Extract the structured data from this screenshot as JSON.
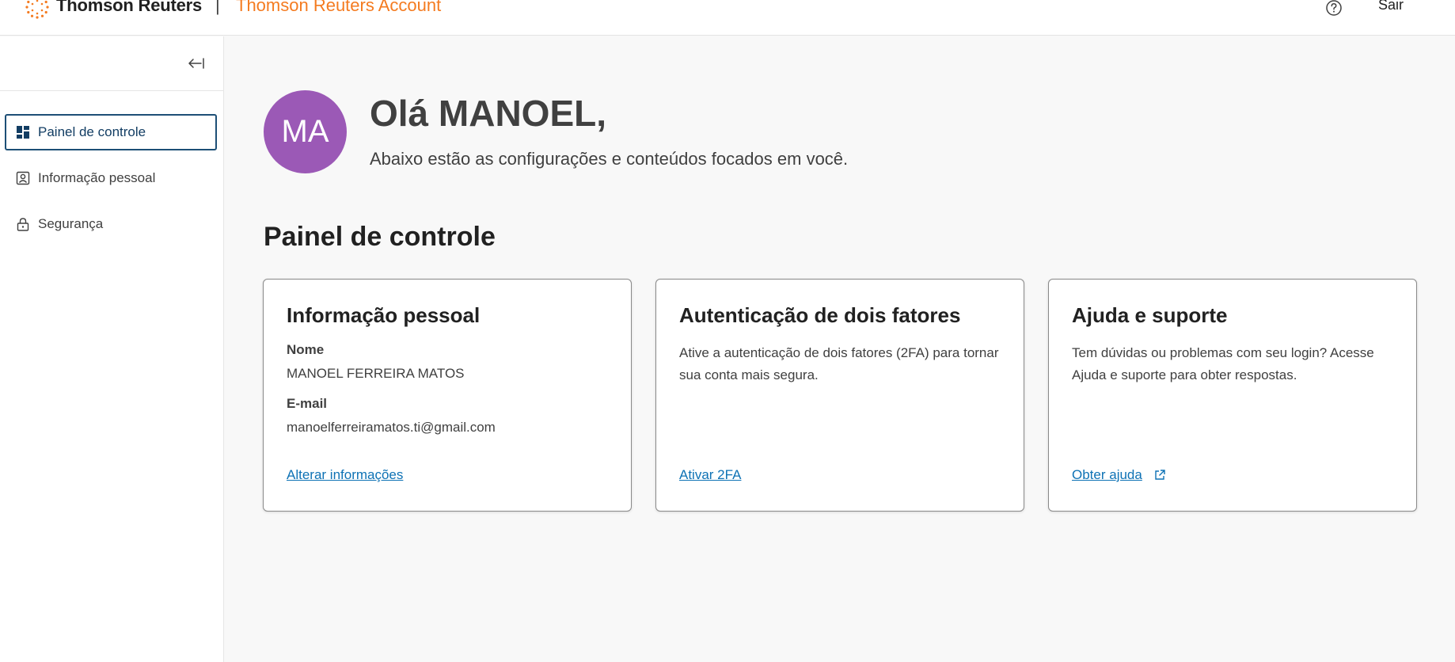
{
  "header": {
    "brand": "Thomson Reuters",
    "separator": "|",
    "product": "Thomson Reuters Account",
    "logout_label": "Sair",
    "help_icon": "question-circle-icon"
  },
  "sidebar": {
    "collapse_icon": "collapse-left-icon",
    "items": [
      {
        "label": "Painel de controle",
        "icon": "dashboard-icon",
        "active": true
      },
      {
        "label": "Informação pessoal",
        "icon": "person-card-icon",
        "active": false
      },
      {
        "label": "Segurança",
        "icon": "lock-icon",
        "active": false
      }
    ]
  },
  "main": {
    "avatar_initials": "MA",
    "avatar_color": "#9b59b6",
    "greeting": "Olá MANOEL,",
    "subtitle": "Abaixo estão as configurações e conteúdos focados em você.",
    "section_title": "Painel de controle",
    "cards": [
      {
        "title": "Informação pessoal",
        "name_label": "Nome",
        "name_value": "MANOEL FERREIRA MATOS",
        "email_label": "E-mail",
        "email_value": "manoelferreiramatos.ti@gmail.com",
        "link": "Alterar informações"
      },
      {
        "title": "Autenticação de dois fatores",
        "text": "Ative a autenticação de dois fatores (2FA) para tornar sua conta mais segura.",
        "link": "Ativar 2FA"
      },
      {
        "title": "Ajuda e suporte",
        "text": "Tem dúvidas ou problemas com seu login? Acesse Ajuda e suporte para obter respostas.",
        "link": "Obter ajuda",
        "link_icon": "external-link-icon"
      }
    ]
  },
  "colors": {
    "accent_orange": "#f47b20",
    "link_blue": "#0e72b5",
    "active_border": "#1d4f76"
  }
}
